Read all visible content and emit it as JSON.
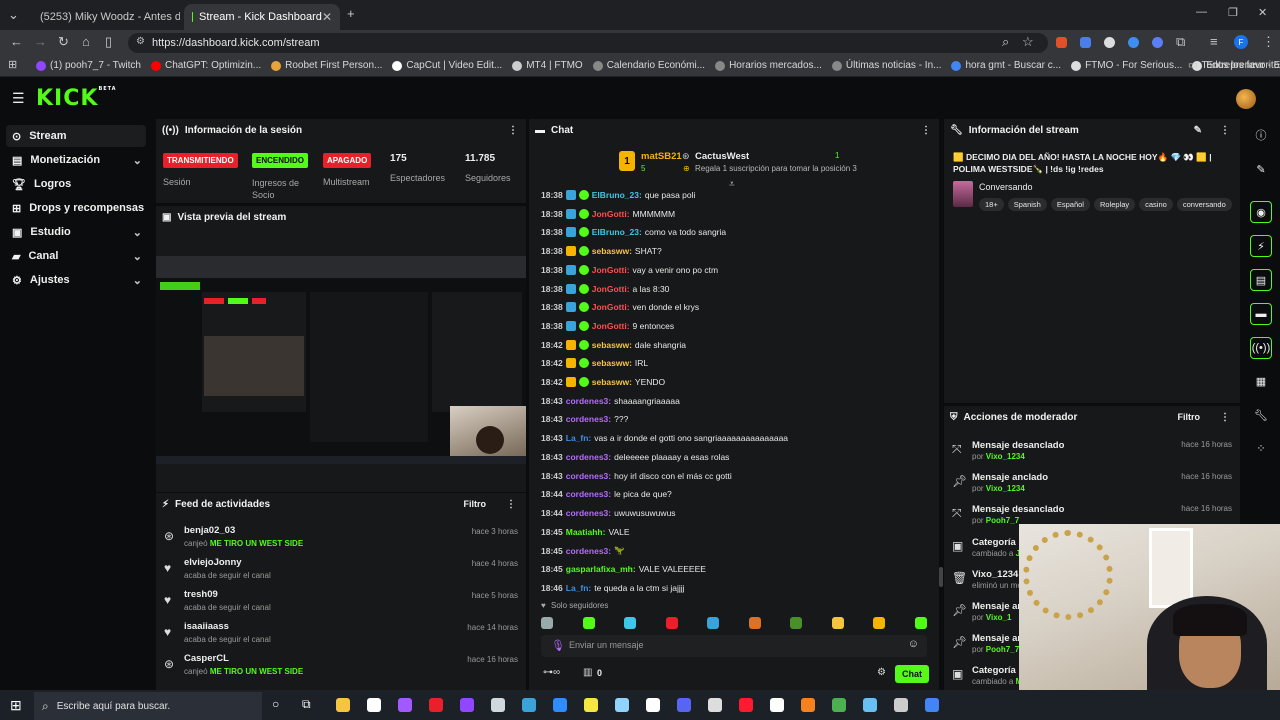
{
  "browser": {
    "tabs": [
      {
        "title": "(5253) Miky Woodz - Antes de",
        "active": false
      },
      {
        "title": "Stream - Kick Dashboard",
        "active": true
      }
    ],
    "url": "https://dashboard.kick.com/stream",
    "bookmarks": [
      "(1) pooh7_7 - Twitch",
      "ChatGPT: Optimizin...",
      "Roobet First Person...",
      "CapCut | Video Edit...",
      "MT4 | FTMO",
      "Calendario Económi...",
      "Horarios mercados...",
      "Últimas noticias - In...",
      "hora gmt - Buscar c...",
      "FTMO - For Serious...",
      "Entrepreneur - Empi..."
    ],
    "all_favorites": "Todos los favoritos"
  },
  "kick": {
    "logo": "KICK",
    "logo_sup": "BETA"
  },
  "sidebar": {
    "items": [
      {
        "label": "Stream",
        "icon": "broadcast-icon",
        "active": true,
        "chevron": false
      },
      {
        "label": "Monetización",
        "icon": "dollar-icon",
        "active": false,
        "chevron": true
      },
      {
        "label": "Logros",
        "icon": "trophy-icon",
        "active": false,
        "chevron": false
      },
      {
        "label": "Drops y recompensas",
        "icon": "gift-icon",
        "active": false,
        "chevron": false
      },
      {
        "label": "Estudio",
        "icon": "studio-icon",
        "active": false,
        "chevron": true
      },
      {
        "label": "Canal",
        "icon": "channel-icon",
        "active": false,
        "chevron": true
      },
      {
        "label": "Ajustes",
        "icon": "gear-icon",
        "active": false,
        "chevron": true
      }
    ]
  },
  "session": {
    "title": "Información de la sesión",
    "stats": [
      {
        "badge": "TRANSMITIENDO",
        "label": "Sesión"
      },
      {
        "badge": "ENCENDIDO",
        "label": "Ingresos de Socio"
      },
      {
        "badge": "APAGADO",
        "label": "Multistream"
      },
      {
        "value": "175",
        "label": "Espectadores"
      },
      {
        "value": "11.785",
        "label": "Seguidores"
      }
    ]
  },
  "preview": {
    "title": "Vista previa del stream"
  },
  "activity": {
    "title": "Feed de actividades",
    "filter": "Filtro",
    "items": [
      {
        "name": "benja02_03",
        "sub_prefix": "canjeó",
        "sub_highlight": "ME TIRO UN WEST SIDE",
        "time": "hace 3 horas",
        "icon": "redeem-icon"
      },
      {
        "name": "elviejoJonny",
        "sub_prefix": "acaba de seguir el canal",
        "sub_highlight": "",
        "time": "hace 4 horas",
        "icon": "heart-icon"
      },
      {
        "name": "tresh09",
        "sub_prefix": "acaba de seguir el canal",
        "sub_highlight": "",
        "time": "hace 5 horas",
        "icon": "heart-icon"
      },
      {
        "name": "isaaiiaass",
        "sub_prefix": "acaba de seguir el canal",
        "sub_highlight": "",
        "time": "hace 14 horas",
        "icon": "heart-icon"
      },
      {
        "name": "CasperCL",
        "sub_prefix": "canjeó",
        "sub_highlight": "ME TIRO UN WEST SIDE",
        "time": "hace 16 horas",
        "icon": "redeem-icon"
      }
    ]
  },
  "chat": {
    "title": "Chat",
    "pinned_user": "matSB21",
    "pinned_count": "5",
    "sub_user": "CactusWest",
    "sub_count": "1",
    "sub_text": "Regala 1 suscripción para tomar la posición 3",
    "messages": [
      {
        "time": "18:38",
        "user": "ElBruno_23",
        "color": "#3ec7e8",
        "badge": "#3aa3d9",
        "text": "que pasa poli"
      },
      {
        "time": "18:38",
        "user": "JonGotti",
        "color": "#ff4f4f",
        "badge": "#3aa3d9",
        "text": "MMMMMM"
      },
      {
        "time": "18:38",
        "user": "ElBruno_23",
        "color": "#3ec7e8",
        "badge": "#3aa3d9",
        "text": "como va todo sangria"
      },
      {
        "time": "18:38",
        "user": "sebasww",
        "color": "#f5c542",
        "badge": "#f5b400",
        "text": "SHAT?"
      },
      {
        "time": "18:38",
        "user": "JonGotti",
        "color": "#ff4f4f",
        "badge": "#3aa3d9",
        "text": "vay a venir ono po ctm"
      },
      {
        "time": "18:38",
        "user": "JonGotti",
        "color": "#ff4f4f",
        "badge": "#3aa3d9",
        "text": "a las 8:30"
      },
      {
        "time": "18:38",
        "user": "JonGotti",
        "color": "#ff4f4f",
        "badge": "#3aa3d9",
        "text": "ven donde el krys"
      },
      {
        "time": "18:38",
        "user": "JonGotti",
        "color": "#ff4f4f",
        "badge": "#3aa3d9",
        "text": "9 entonces"
      },
      {
        "time": "18:42",
        "user": "sebasww",
        "color": "#f5c542",
        "badge": "#f5b400",
        "text": "dale shangria"
      },
      {
        "time": "18:42",
        "user": "sebasww",
        "color": "#f5c542",
        "badge": "#f5b400",
        "text": "IRL"
      },
      {
        "time": "18:42",
        "user": "sebasww",
        "color": "#f5c542",
        "badge": "#f5b400",
        "text": "YENDO"
      },
      {
        "time": "18:43",
        "user": "cordenes3",
        "color": "#b46cff",
        "badge": "",
        "text": "shaaaangriaaaaa"
      },
      {
        "time": "18:43",
        "user": "cordenes3",
        "color": "#b46cff",
        "badge": "",
        "text": "???"
      },
      {
        "time": "18:43",
        "user": "La_fn",
        "color": "#3e8fe8",
        "badge": "",
        "text": "vas a ir donde el gotti ono sangriaaaaaaaaaaaaaaa"
      },
      {
        "time": "18:43",
        "user": "cordenes3",
        "color": "#b46cff",
        "badge": "",
        "text": "deleeeee plaaaay a esas rolas"
      },
      {
        "time": "18:43",
        "user": "cordenes3",
        "color": "#b46cff",
        "badge": "",
        "text": "hoy irl disco con el más cc gotti"
      },
      {
        "time": "18:44",
        "user": "cordenes3",
        "color": "#b46cff",
        "badge": "",
        "text": "le pica de que?"
      },
      {
        "time": "18:44",
        "user": "cordenes3",
        "color": "#b46cff",
        "badge": "",
        "text": "uwuwusuwuwus"
      },
      {
        "time": "18:45",
        "user": "Maatiahh",
        "color": "#53fc18",
        "badge": "",
        "text": "VALE"
      },
      {
        "time": "18:45",
        "user": "cordenes3",
        "color": "#b46cff",
        "badge": "",
        "text": "🦖"
      },
      {
        "time": "18:45",
        "user": "gasparlafixa_mh",
        "color": "#53fc18",
        "badge": "",
        "text": "VALE VALEEEEE"
      },
      {
        "time": "18:46",
        "user": "La_fn",
        "color": "#3e8fe8",
        "badge": "",
        "text": "te queda a la ctm si jajjjj"
      }
    ],
    "followers_only": "Solo seguidores",
    "input_placeholder": "Enviar un mensaje",
    "points": "0",
    "send": "Chat"
  },
  "stream_info": {
    "title": "Información del stream",
    "stream_title": "🟨 DECIMO DIA DEL AÑO! HASTA LA NOCHE HOY🔥 💎 👀 🟨 | POLIMA WESTSIDE🍾 | !ds !ig !redes",
    "category": "Conversando",
    "tags": [
      "18+",
      "Spanish",
      "Español",
      "Roleplay",
      "casino",
      "conversando"
    ]
  },
  "mod_actions": {
    "title": "Acciones de moderador",
    "filter": "Filtro",
    "items": [
      {
        "action": "Mensaje desanclado",
        "prefix": "por",
        "user": "Vixo_1234",
        "time": "hace 16 horas",
        "icon": "unpin-icon"
      },
      {
        "action": "Mensaje anclado",
        "prefix": "por",
        "user": "Vixo_1234",
        "time": "hace 16 horas",
        "icon": "pin-icon"
      },
      {
        "action": "Mensaje desanclado",
        "prefix": "por",
        "user": "Pooh7_7",
        "time": "hace 16 horas",
        "icon": "unpin-icon"
      },
      {
        "action": "Categoría",
        "prefix": "cambiado a",
        "user": "J",
        "time": "",
        "icon": "category-icon"
      },
      {
        "action": "Vixo_1234",
        "prefix": "eliminó un me",
        "user": "",
        "time": "",
        "icon": "trash-icon"
      },
      {
        "action": "Mensaje an",
        "prefix": "por",
        "user": "Vixo_1",
        "time": "",
        "icon": "pin-icon"
      },
      {
        "action": "Mensaje an",
        "prefix": "por",
        "user": "Pooh7_7",
        "time": "",
        "icon": "pin-icon"
      },
      {
        "action": "Categoría",
        "prefix": "cambiado a",
        "user": "M",
        "time": "",
        "icon": "category-icon"
      }
    ]
  },
  "taskbar": {
    "search_placeholder": "Escribe aquí para buscar."
  }
}
